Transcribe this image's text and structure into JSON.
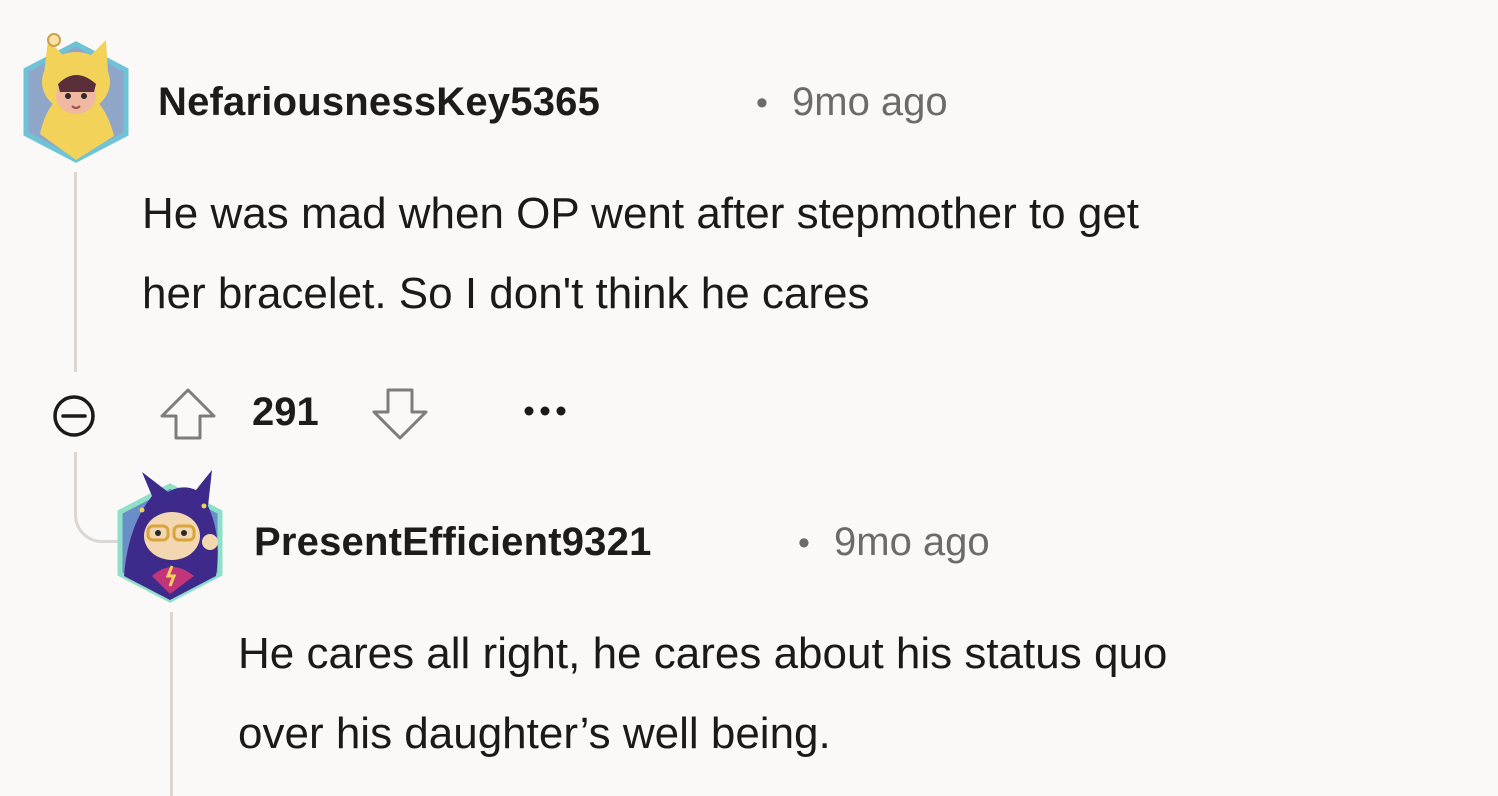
{
  "comments": [
    {
      "username": "NefariousnessKey5365",
      "separator": "•",
      "time": "9mo ago",
      "body_lines": [
        "He was mad when OP went after stepmother to get",
        "her bracelet. So I don't think he cares"
      ],
      "votes": "291",
      "more_label": "•••"
    },
    {
      "username": "PresentEfficient9321",
      "separator": "•",
      "time": "9mo ago",
      "body_lines": [
        "He cares all right, he cares about his status quo",
        "over his daughter’s well being."
      ]
    }
  ],
  "icons": {
    "collapse": "minus-circle-icon",
    "upvote": "arrow-up-outline-icon",
    "downvote": "arrow-down-outline-icon",
    "more": "ellipsis-icon"
  },
  "colors": {
    "background": "#fbf9f8",
    "thread_line": "#dcd6d2",
    "meta_text": "#6b6b6b"
  }
}
